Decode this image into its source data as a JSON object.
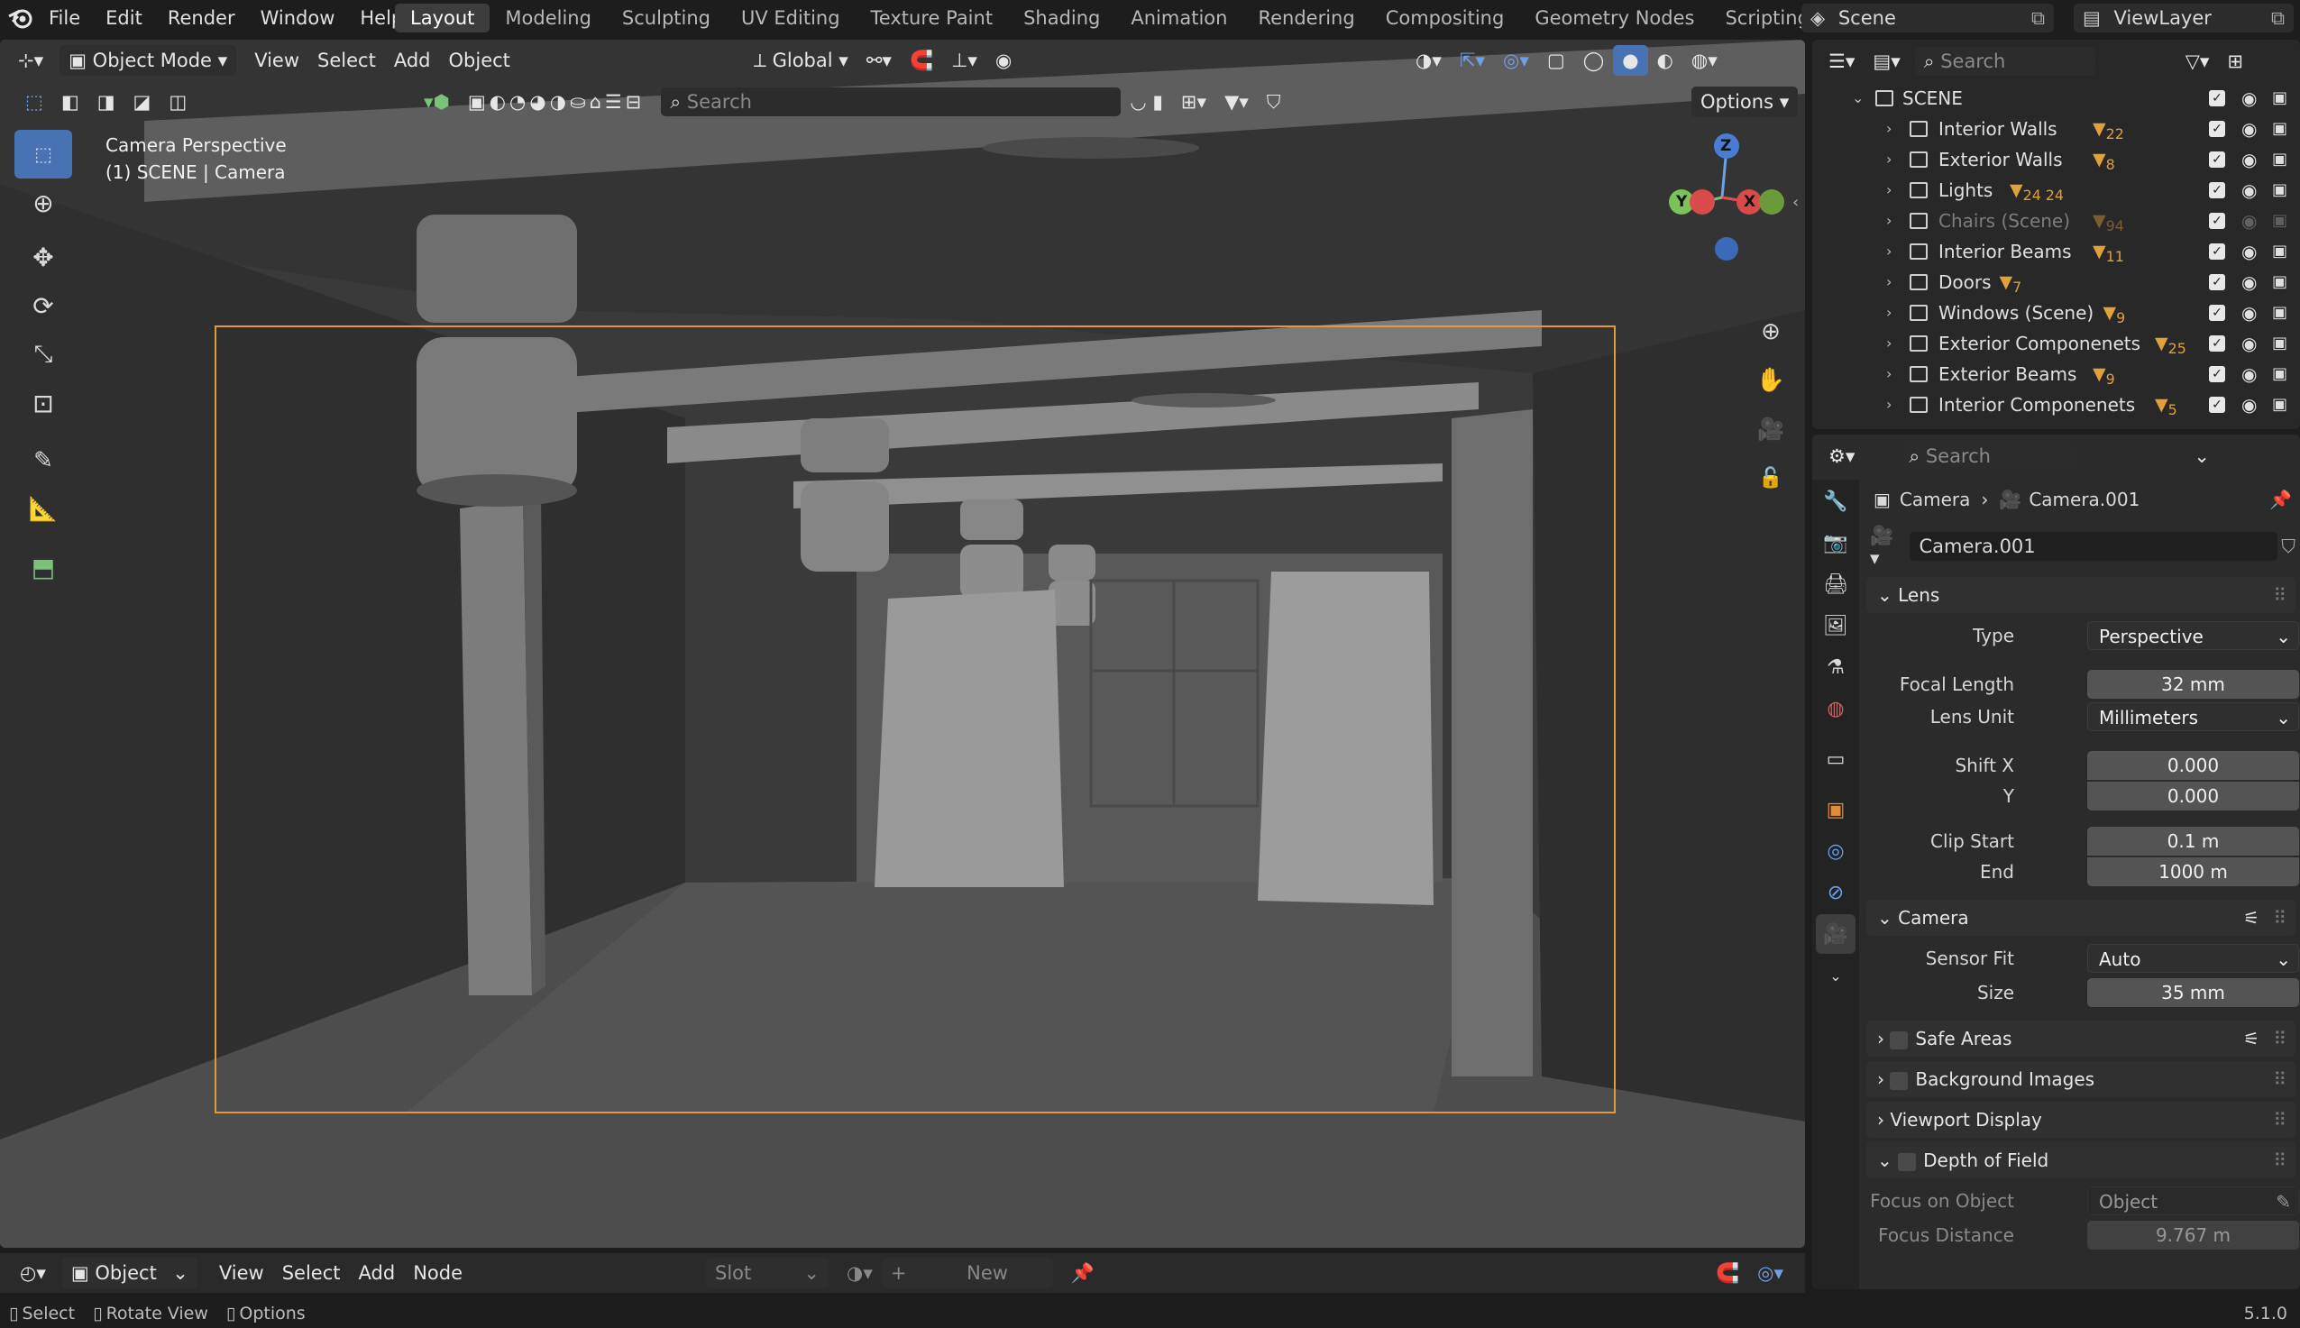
{
  "topbar": {
    "menus": [
      "File",
      "Edit",
      "Render",
      "Window",
      "Help"
    ],
    "workspaces": [
      "Layout",
      "Modeling",
      "Sculpting",
      "UV Editing",
      "Texture Paint",
      "Shading",
      "Animation",
      "Rendering",
      "Compositing",
      "Geometry Nodes",
      "Scripting"
    ],
    "active_workspace": "Layout",
    "scene": "Scene",
    "view_layer": "ViewLayer"
  },
  "viewport": {
    "mode": "Object Mode",
    "menus": [
      "View",
      "Select",
      "Add",
      "Object"
    ],
    "orientation": "Global",
    "search_placeholder": "Search",
    "options_label": "Options",
    "overlay_title": "Camera Perspective",
    "overlay_subtitle": "(1) SCENE | Camera",
    "gizmo": {
      "z": "Z",
      "y": "Y",
      "x": "X"
    }
  },
  "outliner": {
    "search_placeholder": "Search",
    "root": "SCENE",
    "items": [
      {
        "label": "Interior Walls",
        "badge": "22",
        "faded": false
      },
      {
        "label": "Exterior Walls",
        "badge": "8",
        "faded": false
      },
      {
        "label": "Lights",
        "badge": "24  24",
        "faded": false
      },
      {
        "label": "Chairs (Scene)",
        "badge": "94",
        "faded": true
      },
      {
        "label": "Interior Beams",
        "badge": "11",
        "faded": false
      },
      {
        "label": "Doors",
        "badge": "7",
        "faded": false
      },
      {
        "label": "Windows (Scene)",
        "badge": "9",
        "faded": false
      },
      {
        "label": "Exterior Componenets",
        "badge": "25",
        "faded": false
      },
      {
        "label": "Exterior Beams",
        "badge": "9",
        "faded": false
      },
      {
        "label": "Interior Componenets",
        "badge": "5",
        "faded": false
      }
    ]
  },
  "properties": {
    "search_placeholder": "Search",
    "breadcrumb": [
      "Camera",
      "Camera.001"
    ],
    "datablock": "Camera.001",
    "lens": {
      "title": "Lens",
      "type_label": "Type",
      "type_value": "Perspective",
      "focal_label": "Focal Length",
      "focal_value": "32 mm",
      "unit_label": "Lens Unit",
      "unit_value": "Millimeters",
      "shiftx_label": "Shift X",
      "shiftx_value": "0.000",
      "shifty_label": "Y",
      "shifty_value": "0.000",
      "clipstart_label": "Clip Start",
      "clipstart_value": "0.1 m",
      "clipend_label": "End",
      "clipend_value": "1000 m"
    },
    "camera": {
      "title": "Camera",
      "fit_label": "Sensor Fit",
      "fit_value": "Auto",
      "size_label": "Size",
      "size_value": "35 mm"
    },
    "panels": [
      "Safe Areas",
      "Background Images",
      "Viewport Display",
      "Depth of Field"
    ],
    "dof": {
      "focus_obj_label": "Focus on Object",
      "focus_obj_placeholder": "Object",
      "focus_dist_label": "Focus Distance",
      "focus_dist_value": "9.767 m"
    }
  },
  "timeline": {
    "mode": "Object",
    "menus": [
      "View",
      "Select",
      "Add",
      "Node"
    ],
    "slot": "Slot",
    "new_label": "New"
  },
  "status": {
    "items": [
      "Select",
      "Rotate View",
      "Options"
    ],
    "version": "5.1.0"
  }
}
